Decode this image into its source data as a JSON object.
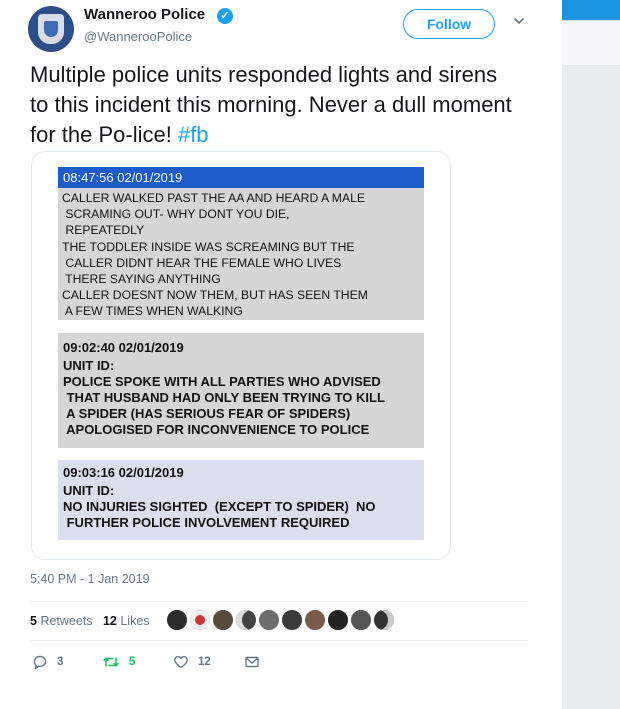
{
  "account": {
    "display_name": "Wanneroo Police",
    "handle": "@WannerooPolice",
    "verified_mark": "✓"
  },
  "header": {
    "follow_label": "Follow",
    "menu_icon": "chevron-down-icon"
  },
  "tweet": {
    "text": "Multiple police units responded lights and sirens to this incident this morning.  Never a dull moment for the Po-lice! ",
    "hashtag": "#fb",
    "hashtag_color": "#1da1f2",
    "timestamp": "5:40 PM - 1 Jan 2019"
  },
  "image": {
    "log1": {
      "time": "08:47:56 02/01/2019",
      "lines": [
        "CALLER WALKED PAST THE AA AND HEARD A MALE",
        " SCRAMING OUT- WHY DONT YOU DIE,",
        " REPEATEDLY",
        "THE TODDLER INSIDE WAS SCREAMING BUT THE",
        " CALLER DIDNT HEAR THE FEMALE WHO LIVES",
        " THERE SAYING ANYTHING",
        "CALLER DOESNT NOW THEM, BUT HAS SEEN THEM",
        " A FEW TIMES WHEN WALKING"
      ]
    },
    "log2": {
      "time": "09:02:40  02/01/2019",
      "lines": [
        "UNIT ID:",
        "POLICE SPOKE WITH ALL PARTIES WHO ADVISED",
        " THAT HUSBAND HAD ONLY BEEN TRYING TO KILL",
        " A SPIDER (HAS SERIOUS FEAR OF SPIDERS)",
        " APOLOGISED FOR INCONVENIENCE TO POLICE"
      ]
    },
    "log3": {
      "time": "09:03:16  02/01/2019",
      "lines": [
        "UNIT ID:",
        "NO INJURIES SIGHTED  (EXCEPT TO SPIDER)  NO",
        " FURTHER POLICE INVOLVEMENT REQUIRED"
      ]
    }
  },
  "stats": {
    "retweets_count": "5",
    "retweets_label": "Retweets",
    "likes_count": "12",
    "likes_label": "Likes"
  },
  "actions": {
    "reply_count": "3",
    "retweet_count": "5",
    "like_count": "12",
    "retweet_color": "#17bf63"
  },
  "colors": {
    "accent": "#1da1f2",
    "log_header": "#1d5bc9",
    "log_bg": "#d6d6d6",
    "log_bg_alt": "#dcdfee",
    "gutter_top": "#1b95e0"
  }
}
